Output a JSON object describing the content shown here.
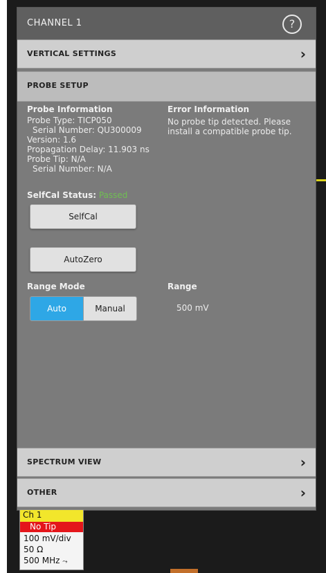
{
  "panel": {
    "title": "CHANNEL 1",
    "help_icon": "?"
  },
  "sections": {
    "vertical_settings": "VERTICAL SETTINGS",
    "probe_setup": "PROBE SETUP",
    "spectrum_view": "SPECTRUM VIEW",
    "other": "OTHER",
    "chevron": "›"
  },
  "probe_info": {
    "heading": "Probe Information",
    "probe_type": "Probe Type: TICP050",
    "serial_number": "Serial Number: QU300009",
    "version": "Version: 1.6",
    "propagation_delay": "Propagation Delay: 11.903 ns",
    "probe_tip": "Probe Tip: N/A",
    "tip_serial_number": "Serial Number: N/A"
  },
  "error_info": {
    "heading": "Error Information",
    "message": "No probe tip detected. Please install a compatible probe tip."
  },
  "selfcal": {
    "status_label": "SelfCal Status:",
    "status_value": "Passed",
    "status_color": "#6fbf52",
    "button": "SelfCal"
  },
  "autozero": {
    "button": "AutoZero"
  },
  "range_mode": {
    "label": "Range Mode",
    "options": [
      "Auto",
      "Manual"
    ],
    "selected": "Auto",
    "accent": "#2ea7e6"
  },
  "range": {
    "label": "Range",
    "value": "500 mV"
  },
  "channel_badge": {
    "name": "Ch 1",
    "warning": "No Tip",
    "scale": "100 mV/div",
    "impedance": "50 Ω",
    "bandwidth": "500 MHz",
    "bandwidth_icon": "bandwidth-limit-icon",
    "tab_color": "#f2e62b",
    "warning_color": "#e4161b"
  }
}
